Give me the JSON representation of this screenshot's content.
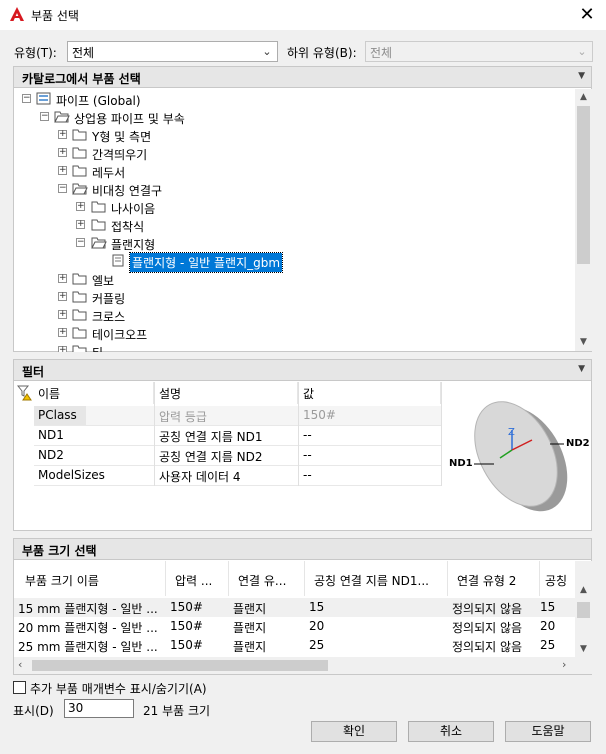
{
  "window": {
    "title": "부품 선택"
  },
  "filters": {
    "type_label": "유형(T):",
    "type_value": "전체",
    "subtype_label": "하위 유형(B):",
    "subtype_value": "전체"
  },
  "catalog": {
    "header": "카탈로그에서 부품 선택",
    "tree": [
      "파이프 (Global)",
      "상업용 파이프 및 부속",
      "Y형 및 측면",
      "간격띄우기",
      "레두서",
      "비대칭 연결구",
      "나사이음",
      "접착식",
      "플랜지형",
      "플랜지형 - 일반 플랜지_gbm",
      "엘보",
      "커플링",
      "크로스",
      "테이크오프",
      "티"
    ]
  },
  "filter_panel": {
    "header": "필터",
    "columns": [
      "이름",
      "설명",
      "값"
    ],
    "rows": [
      {
        "name": "PClass",
        "desc": "압력 등급",
        "value": "150#"
      },
      {
        "name": "ND1",
        "desc": "공칭 연결 지름 ND1",
        "value": "--"
      },
      {
        "name": "ND2",
        "desc": "공칭 연결 지름 ND2",
        "value": "--"
      },
      {
        "name": "ModelSizes",
        "desc": "사용자 데이터 4",
        "value": "--"
      }
    ],
    "preview_labels": {
      "nd1": "ND1",
      "nd2": "ND2",
      "z": "Z"
    }
  },
  "size_panel": {
    "header": "부품 크기 선택",
    "columns": [
      "부품 크기 이름",
      "압력 ...",
      "연결 유...",
      "공칭 연결 지름 ND1...",
      "연결 유형 2",
      "공칭"
    ],
    "rows": [
      [
        "15 mm 플랜지형 - 일반 ...",
        "150#",
        "플랜지",
        "15",
        "정의되지 않음",
        "15"
      ],
      [
        "20 mm 플랜지형 - 일반 ...",
        "150#",
        "플랜지",
        "20",
        "정의되지 않음",
        "20"
      ],
      [
        "25 mm 플랜지형 - 일반 ...",
        "150#",
        "플랜지",
        "25",
        "정의되지 않음",
        "25"
      ]
    ]
  },
  "footer": {
    "checkbox_label": "추가 부품 매개변수 표시/숨기기(A)",
    "show_label": "표시(D)",
    "show_value": "30",
    "count_text": "21 부품 크기",
    "ok": "확인",
    "cancel": "취소",
    "help": "도움말"
  },
  "colors": {
    "selection": "#0078d7",
    "title_icon": "#d71920"
  }
}
